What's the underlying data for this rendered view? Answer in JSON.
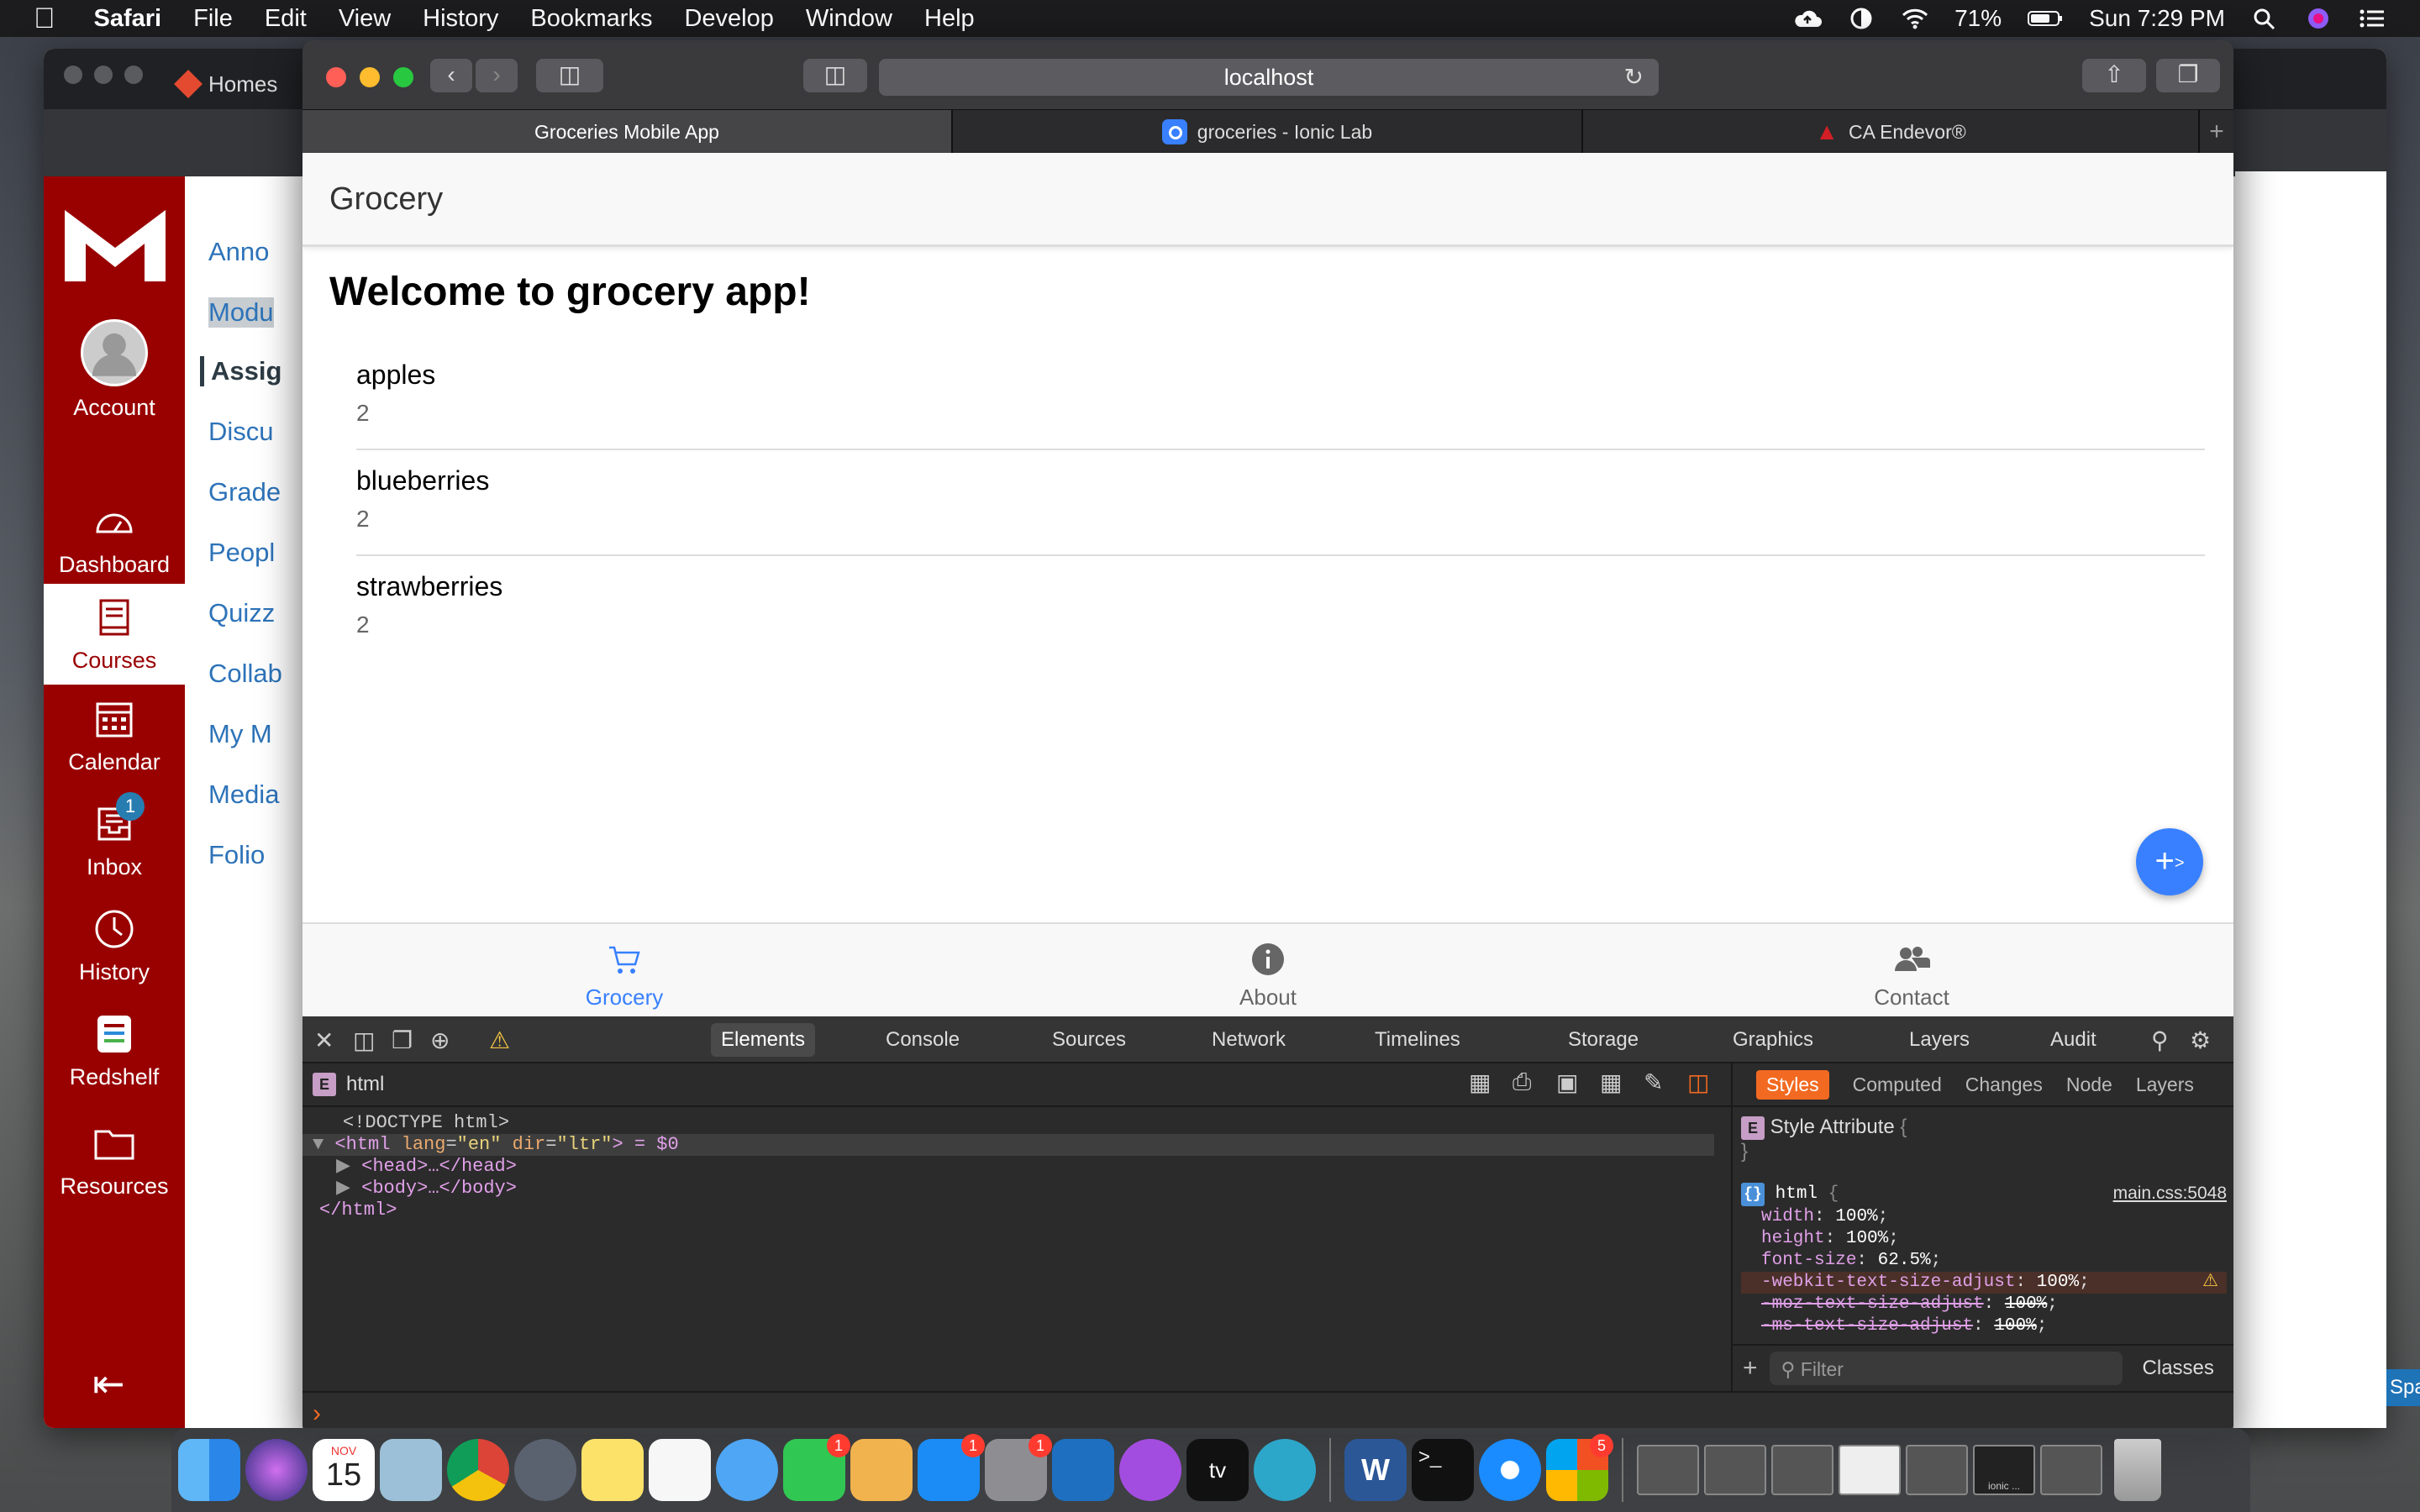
{
  "menubar": {
    "app": "Safari",
    "items": [
      "File",
      "Edit",
      "View",
      "History",
      "Bookmarks",
      "Develop",
      "Window",
      "Help"
    ],
    "battery": "71%",
    "clock": "Sun 7:29 PM"
  },
  "chrome": {
    "tab_title": "Homes",
    "url_fragment": "m",
    "rail": {
      "account": "Account",
      "dashboard": "Dashboard",
      "courses": "Courses",
      "calendar": "Calendar",
      "inbox": "Inbox",
      "inbox_badge": "1",
      "history": "History",
      "redshelf": "Redshelf",
      "resources": "Resources"
    },
    "course_nav": [
      "Anno",
      "Modu",
      "Assig",
      "Discu",
      "Grade",
      "Peopl",
      "Quizz",
      "Collab",
      "My M",
      "Media",
      "Folio"
    ],
    "right_button": "Spa"
  },
  "safari": {
    "url": "localhost",
    "tabs": [
      {
        "label": "Groceries Mobile App"
      },
      {
        "label": "groceries - Ionic Lab"
      },
      {
        "label": "CA Endevor®"
      }
    ]
  },
  "app": {
    "title": "Grocery",
    "welcome": "Welcome to grocery app!",
    "items": [
      {
        "name": "apples",
        "quantity": "2"
      },
      {
        "name": "blueberries",
        "quantity": "2"
      },
      {
        "name": "strawberries",
        "quantity": "2"
      }
    ],
    "fab_label": "+",
    "fab_arrow": ">",
    "tabs": {
      "grocery": "Grocery",
      "about": "About",
      "contact": "Contact"
    },
    "accent": "#3880ff"
  },
  "devtools": {
    "tabs": [
      "Elements",
      "Console",
      "Sources",
      "Network",
      "Timelines",
      "Storage",
      "Graphics",
      "Layers",
      "Audit"
    ],
    "breadcrumb": "html",
    "dom": {
      "doctype": "<!DOCTYPE html>",
      "html_open": "<html",
      "lang_attr": "lang",
      "lang_val": "\"en\"",
      "dir_attr": "dir",
      "dir_val": "\"ltr\"",
      "html_suffix": "> = $0",
      "head": "<head>…</head>",
      "body": "<body>…</body>",
      "html_close": "</html>"
    },
    "styles_tabs": [
      "Styles",
      "Computed",
      "Changes",
      "Node",
      "Layers"
    ],
    "style_attribute": "Style Attribute",
    "rule_selector": "html",
    "rule_source": "main.css:5048",
    "properties": [
      {
        "name": "width",
        "value": "100%"
      },
      {
        "name": "height",
        "value": "100%"
      },
      {
        "name": "font-size",
        "value": "62.5%"
      },
      {
        "name": "-webkit-text-size-adjust",
        "value": "100%"
      },
      {
        "name": "-moz-text-size-adjust",
        "value": "100%"
      },
      {
        "name": "-ms-text-size-adjust",
        "value": "100%"
      }
    ],
    "filter_placeholder": "Filter",
    "classes_label": "Classes"
  },
  "dock": {
    "calendar_month": "NOV",
    "calendar_day": "15",
    "badges": {
      "facetime": "1",
      "appstore": "1",
      "sysprefs": "1",
      "office": "5"
    },
    "tv_label": "tv",
    "word_label": "W",
    "terminal_label": ">_",
    "thumb_label": "ionic ..."
  }
}
